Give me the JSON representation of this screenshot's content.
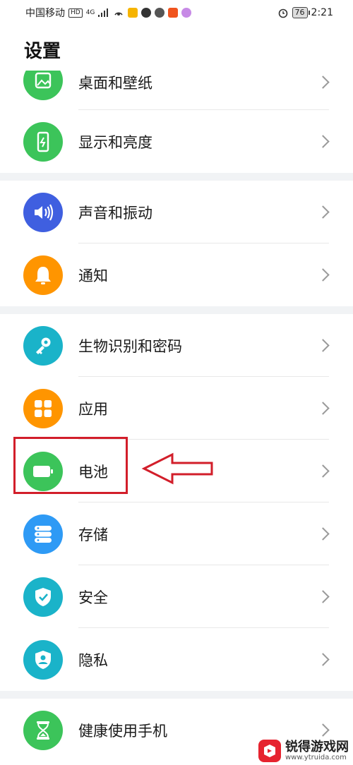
{
  "statusbar": {
    "carrier": "中国移动",
    "hd": "HD",
    "network": "4G",
    "time": "2:21",
    "battery": "76"
  },
  "page_title": "设置",
  "items": [
    {
      "label": "桌面和壁纸",
      "icon": "wallpaper-icon",
      "color": "#3cc45a"
    },
    {
      "label": "显示和亮度",
      "icon": "display-icon",
      "color": "#3cc45a"
    },
    {
      "label": "声音和振动",
      "icon": "sound-icon",
      "color": "#3f5fe0"
    },
    {
      "label": "通知",
      "icon": "bell-icon",
      "color": "#ff9500"
    },
    {
      "label": "生物识别和密码",
      "icon": "key-icon",
      "color": "#1ab3c9"
    },
    {
      "label": "应用",
      "icon": "apps-icon",
      "color": "#ff9500"
    },
    {
      "label": "电池",
      "icon": "battery-icon",
      "color": "#3cc45a"
    },
    {
      "label": "存储",
      "icon": "storage-icon",
      "color": "#2e9af5"
    },
    {
      "label": "安全",
      "icon": "shield-check-icon",
      "color": "#1ab3c9"
    },
    {
      "label": "隐私",
      "icon": "privacy-icon",
      "color": "#1ab3c9"
    },
    {
      "label": "健康使用手机",
      "icon": "hourglass-icon",
      "color": "#3cc45a"
    }
  ],
  "watermark": {
    "name": "锐得游戏网",
    "url": "www.ytruida.com"
  },
  "colors": {
    "highlight": "#d21e2a",
    "divider": "#e8e8e8",
    "section_gap": "#f1f3f5"
  }
}
